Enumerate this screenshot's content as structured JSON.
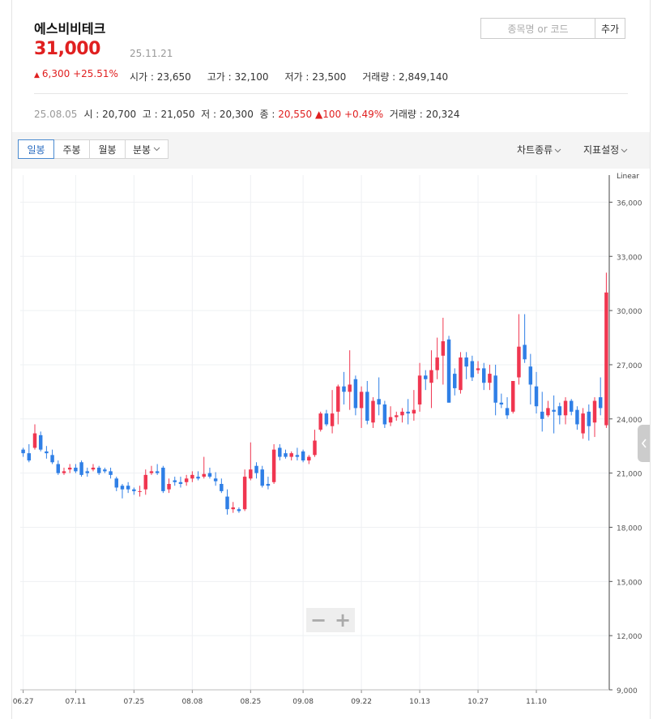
{
  "header": {
    "name": "에스비비테크",
    "price": "31,000",
    "date": "25.11.21",
    "change_arrow": "▲",
    "change_text": "6,300 +25.51%",
    "stats": {
      "open": "시가 : 23,650",
      "high": "고가 : 32,100",
      "low": "저가 : 23,500",
      "volume": "거래량 : 2,849,140"
    }
  },
  "search": {
    "placeholder": "종목명 or 코드",
    "add_label": "추가"
  },
  "ohlc_bar": {
    "date": "25.08.05",
    "open": "시 : 20,700",
    "high": "고 : 21,050",
    "low": "저 : 20,300",
    "close_label": "종 : ",
    "close_value": "20,550",
    "change": "▲100 +0.49%",
    "volume": "거래량 : 20,324"
  },
  "toolbar": {
    "tabs": [
      "일봉",
      "주봉",
      "월봉",
      "분봉"
    ],
    "chart_type": "차트종류",
    "indicator": "지표설정"
  },
  "zoom": {
    "minus": "−",
    "plus": "+"
  },
  "colors": {
    "up": "#f03650",
    "down": "#2f7fe6",
    "accent": "#e02020"
  },
  "chart_data": {
    "type": "candlestick",
    "scale_label": "Linear",
    "ylim": [
      9000,
      37500
    ],
    "y_ticks": [
      9000,
      12000,
      15000,
      18000,
      21000,
      24000,
      27000,
      30000,
      33000,
      36000
    ],
    "y_tick_labels": [
      "9,000",
      "12,000",
      "15,000",
      "18,000",
      "21,000",
      "24,000",
      "27,000",
      "30,000",
      "33,000",
      "36,000"
    ],
    "x_labels": [
      {
        "index": 0,
        "label": "06.27"
      },
      {
        "index": 9,
        "label": "07.11"
      },
      {
        "index": 19,
        "label": "07.25"
      },
      {
        "index": 29,
        "label": "08.08"
      },
      {
        "index": 39,
        "label": "08.25"
      },
      {
        "index": 48,
        "label": "09.08"
      },
      {
        "index": 58,
        "label": "09.22"
      },
      {
        "index": 68,
        "label": "10.13"
      },
      {
        "index": 78,
        "label": "10.27"
      },
      {
        "index": 88,
        "label": "11.10"
      }
    ],
    "ohlc": [
      [
        22300,
        22400,
        21900,
        22100
      ],
      [
        22100,
        22600,
        21600,
        21700
      ],
      [
        22400,
        23700,
        22300,
        23200
      ],
      [
        23100,
        23300,
        22200,
        22300
      ],
      [
        22200,
        22500,
        21800,
        22100
      ],
      [
        22000,
        22300,
        21500,
        21600
      ],
      [
        21500,
        21700,
        20900,
        21000
      ],
      [
        21000,
        21300,
        20900,
        21100
      ],
      [
        21200,
        21500,
        21000,
        21300
      ],
      [
        21300,
        21500,
        21000,
        21100
      ],
      [
        21600,
        21700,
        20800,
        20900
      ],
      [
        21100,
        21300,
        20800,
        21000
      ],
      [
        21200,
        21500,
        21100,
        21300
      ],
      [
        21300,
        21400,
        20900,
        21000
      ],
      [
        21200,
        21300,
        21000,
        21100
      ],
      [
        21100,
        21300,
        20700,
        20900
      ],
      [
        20700,
        20800,
        20000,
        20200
      ],
      [
        20300,
        20400,
        19600,
        20100
      ],
      [
        20300,
        20500,
        19900,
        20100
      ],
      [
        20100,
        20200,
        19800,
        20000
      ],
      [
        20000,
        20300,
        19700,
        20000
      ],
      [
        20100,
        21200,
        19800,
        20900
      ],
      [
        21000,
        21400,
        20900,
        21100
      ],
      [
        21100,
        21500,
        20900,
        21000
      ],
      [
        21300,
        21400,
        19900,
        20000
      ],
      [
        20100,
        20700,
        19900,
        20400
      ],
      [
        20600,
        20800,
        20300,
        20500
      ],
      [
        20500,
        20800,
        20200,
        20400
      ],
      [
        20500,
        20900,
        20300,
        20700
      ],
      [
        20700,
        21100,
        20500,
        20900
      ],
      [
        20800,
        21100,
        20600,
        20700
      ],
      [
        20800,
        21900,
        20700,
        20950
      ],
      [
        21000,
        21300,
        20700,
        20800
      ],
      [
        20700,
        21050,
        20300,
        20550
      ],
      [
        20400,
        20700,
        19900,
        20000
      ],
      [
        19700,
        20100,
        18700,
        19000
      ],
      [
        19000,
        19400,
        18800,
        19100
      ],
      [
        19000,
        19100,
        18800,
        18900
      ],
      [
        19000,
        21200,
        18900,
        20800
      ],
      [
        20700,
        22700,
        20600,
        21200
      ],
      [
        21400,
        21600,
        20700,
        21000
      ],
      [
        21200,
        21400,
        20200,
        20300
      ],
      [
        20400,
        20800,
        20100,
        20300
      ],
      [
        20500,
        22600,
        20400,
        22300
      ],
      [
        22400,
        22600,
        21700,
        21900
      ],
      [
        22100,
        22300,
        21800,
        21900
      ],
      [
        21900,
        22200,
        21700,
        22100
      ],
      [
        22000,
        22400,
        21700,
        21900
      ],
      [
        22200,
        22300,
        21600,
        21700
      ],
      [
        21700,
        22000,
        21500,
        21900
      ],
      [
        22000,
        23400,
        21900,
        22800
      ],
      [
        23400,
        24400,
        23300,
        24300
      ],
      [
        24300,
        24500,
        23600,
        23700
      ],
      [
        23600,
        25600,
        23200,
        24300
      ],
      [
        24400,
        25900,
        23700,
        25800
      ],
      [
        25800,
        26600,
        24800,
        25500
      ],
      [
        25500,
        27800,
        24500,
        25900
      ],
      [
        26200,
        26400,
        24200,
        24600
      ],
      [
        24600,
        25800,
        23500,
        25500
      ],
      [
        25500,
        26100,
        23700,
        23900
      ],
      [
        23800,
        25200,
        23500,
        25000
      ],
      [
        25100,
        26300,
        24200,
        24800
      ],
      [
        24800,
        25000,
        23500,
        23700
      ],
      [
        23800,
        24700,
        23600,
        24100
      ],
      [
        24100,
        24400,
        23900,
        24200
      ],
      [
        24200,
        24600,
        23800,
        24400
      ],
      [
        24400,
        25100,
        23700,
        24300
      ],
      [
        24300,
        25600,
        23900,
        24500
      ],
      [
        24800,
        27100,
        24400,
        26400
      ],
      [
        26400,
        26700,
        25600,
        26200
      ],
      [
        26000,
        27800,
        24600,
        26700
      ],
      [
        26700,
        28500,
        26200,
        27400
      ],
      [
        27500,
        29600,
        25900,
        28300
      ],
      [
        28400,
        28600,
        24900,
        24900
      ],
      [
        26500,
        26800,
        25300,
        25700
      ],
      [
        25600,
        27700,
        25400,
        27400
      ],
      [
        27400,
        27700,
        26200,
        26900
      ],
      [
        27200,
        27500,
        26100,
        26300
      ],
      [
        26700,
        27200,
        26500,
        26800
      ],
      [
        26800,
        27100,
        25600,
        26000
      ],
      [
        26000,
        27000,
        25600,
        26500
      ],
      [
        26400,
        27000,
        24200,
        24900
      ],
      [
        24900,
        25400,
        24600,
        24800
      ],
      [
        24600,
        25200,
        24000,
        24200
      ],
      [
        24400,
        26100,
        24300,
        26100
      ],
      [
        26300,
        29800,
        25900,
        28000
      ],
      [
        28100,
        29800,
        27100,
        27300
      ],
      [
        26900,
        27600,
        24800,
        25900
      ],
      [
        25800,
        26600,
        24300,
        24700
      ],
      [
        24400,
        25500,
        23300,
        24000
      ],
      [
        24200,
        25000,
        24100,
        24600
      ],
      [
        24500,
        25300,
        23200,
        24400
      ],
      [
        24700,
        24900,
        23700,
        24200
      ],
      [
        24200,
        25200,
        23700,
        25000
      ],
      [
        25000,
        25100,
        24200,
        24400
      ],
      [
        24500,
        24700,
        23400,
        23700
      ],
      [
        23200,
        24600,
        22900,
        24300
      ],
      [
        24400,
        24800,
        22800,
        23600
      ],
      [
        23800,
        25200,
        23000,
        25000
      ],
      [
        25200,
        26300,
        24200,
        24600
      ],
      [
        23650,
        32100,
        23500,
        31000
      ]
    ]
  }
}
